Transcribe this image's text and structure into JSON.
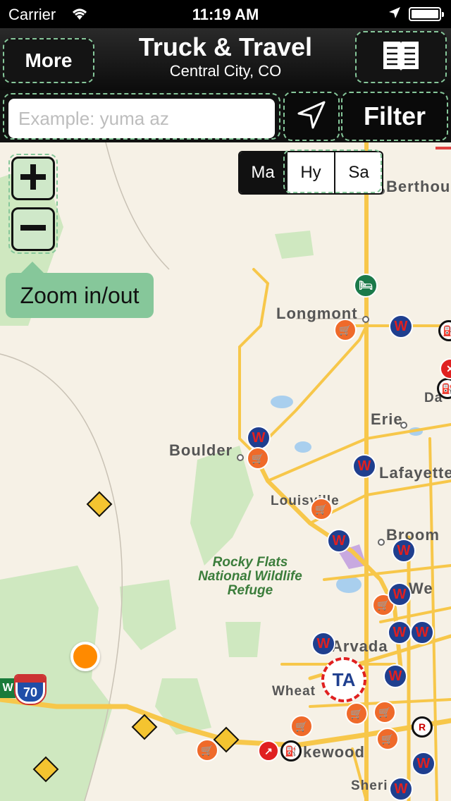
{
  "status_bar": {
    "carrier": "Carrier",
    "time": "11:19 AM"
  },
  "nav": {
    "more_label": "More",
    "title": "Truck & Travel",
    "subtitle": "Central City, CO",
    "book_icon": "book-icon"
  },
  "search": {
    "placeholder": "Example: yuma az",
    "value": "",
    "locate_icon": "location-arrow-icon",
    "filter_label": "Filter"
  },
  "map": {
    "map_types": [
      "Ma",
      "Hy",
      "Sa"
    ],
    "selected_type": "Ma",
    "zoom_in_icon": "plus-icon",
    "zoom_out_icon": "minus-icon",
    "zoom_tip": "Zoom in/out",
    "places": {
      "berthoud": "Berthoud",
      "longmont": "Longmont",
      "erie": "Erie",
      "boulder": "Boulder",
      "lafayette": "Lafayette",
      "louisville": "Louisville",
      "broomfield": "Broom",
      "westminster": "We",
      "arvada": "Arvada",
      "wheat_ridge": "Wheat",
      "lakewood": "kewood",
      "sheridan": "Sheri",
      "dacono": "Da"
    },
    "park_label": "Rocky Flats National Wildlife Refuge",
    "interstate": "70",
    "colors": {
      "map_bg": "#f6f1e6",
      "road": "#f7c74a",
      "park": "#cfe8c0",
      "water": "#a9cfee",
      "accent": "#86c79a"
    }
  }
}
